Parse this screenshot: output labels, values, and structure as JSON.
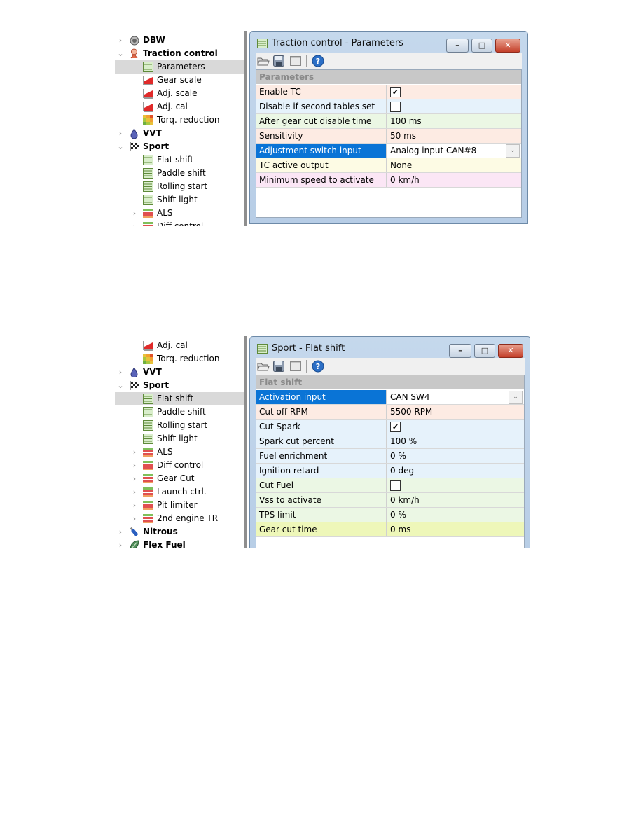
{
  "screenshot1": {
    "tree": [
      {
        "label": "DBW",
        "icon": "throttle-body-icon",
        "bold": true,
        "chevron": "collapsed",
        "level": 0
      },
      {
        "label": "Traction control",
        "icon": "traction-control-icon",
        "bold": true,
        "chevron": "expanded",
        "level": 0
      },
      {
        "label": "Parameters",
        "icon": "parameters-table-icon",
        "level": 1,
        "selected": true
      },
      {
        "label": "Gear scale",
        "icon": "curve-table-icon",
        "level": 1
      },
      {
        "label": "Adj. scale",
        "icon": "curve-table-icon",
        "level": 1
      },
      {
        "label": "Adj. cal",
        "icon": "curve-table-icon",
        "level": 1
      },
      {
        "label": "Torq. reduction",
        "icon": "map-table-icon",
        "level": 1
      },
      {
        "label": "VVT",
        "icon": "oil-drop-icon",
        "bold": true,
        "chevron": "collapsed",
        "level": 0
      },
      {
        "label": "Sport",
        "icon": "checkered-flag-icon",
        "bold": true,
        "chevron": "expanded",
        "level": 0
      },
      {
        "label": "Flat shift",
        "icon": "parameters-table-icon",
        "level": 1
      },
      {
        "label": "Paddle shift",
        "icon": "parameters-table-icon",
        "level": 1
      },
      {
        "label": "Rolling start",
        "icon": "parameters-table-icon",
        "level": 1
      },
      {
        "label": "Shift light",
        "icon": "parameters-table-icon",
        "level": 1
      },
      {
        "label": "ALS",
        "icon": "group-table-icon",
        "chevron": "collapsed",
        "level": 1
      },
      {
        "label": "Diff control",
        "icon": "group-table-icon",
        "chevron": "collapsed",
        "level": 1
      }
    ],
    "window": {
      "title": "Traction control - Parameters",
      "section_header": "Parameters",
      "rows": [
        {
          "label": "Enable TC",
          "type": "checkbox",
          "checked": true,
          "color": "salmon"
        },
        {
          "label": "Disable if second tables set",
          "type": "checkbox",
          "checked": false,
          "color": "blue"
        },
        {
          "label": "After gear cut disable time",
          "value": "100 ms",
          "color": "green"
        },
        {
          "label": "Sensitivity",
          "value": "50 ms",
          "color": "salmon"
        },
        {
          "label": "Adjustment switch input",
          "value": "Analog input CAN#8",
          "type": "dropdown",
          "selected": true
        },
        {
          "label": "TC active output",
          "value": "None",
          "color": "yellow"
        },
        {
          "label": "Minimum speed to activate",
          "value": "0 km/h",
          "color": "pink"
        }
      ]
    }
  },
  "screenshot2": {
    "tree": [
      {
        "label": "Adj. cal",
        "icon": "curve-table-icon",
        "level": 1
      },
      {
        "label": "Torq. reduction",
        "icon": "map-table-icon",
        "level": 1
      },
      {
        "label": "VVT",
        "icon": "oil-drop-icon",
        "bold": true,
        "chevron": "collapsed",
        "level": 0
      },
      {
        "label": "Sport",
        "icon": "checkered-flag-icon",
        "bold": true,
        "chevron": "expanded",
        "level": 0
      },
      {
        "label": "Flat shift",
        "icon": "parameters-table-icon",
        "level": 1,
        "selected": true
      },
      {
        "label": "Paddle shift",
        "icon": "parameters-table-icon",
        "level": 1
      },
      {
        "label": "Rolling start",
        "icon": "parameters-table-icon",
        "level": 1
      },
      {
        "label": "Shift light",
        "icon": "parameters-table-icon",
        "level": 1
      },
      {
        "label": "ALS",
        "icon": "group-table-icon",
        "chevron": "collapsed",
        "level": 1
      },
      {
        "label": "Diff control",
        "icon": "group-table-icon",
        "chevron": "collapsed",
        "level": 1
      },
      {
        "label": "Gear Cut",
        "icon": "group-table-icon",
        "chevron": "collapsed",
        "level": 1
      },
      {
        "label": "Launch ctrl.",
        "icon": "group-table-icon",
        "chevron": "collapsed",
        "level": 1
      },
      {
        "label": "Pit limiter",
        "icon": "group-table-icon",
        "chevron": "collapsed",
        "level": 1
      },
      {
        "label": "2nd engine TR",
        "icon": "group-table-icon",
        "chevron": "collapsed",
        "level": 1
      },
      {
        "label": "Nitrous",
        "icon": "nitrous-bottle-icon",
        "bold": true,
        "chevron": "collapsed",
        "level": 0
      },
      {
        "label": "Flex Fuel",
        "icon": "leaf-icon",
        "bold": true,
        "chevron": "collapsed",
        "level": 0
      }
    ],
    "window": {
      "title": "Sport - Flat shift",
      "section_header": "Flat shift",
      "rows": [
        {
          "label": "Activation input",
          "value": "CAN SW4",
          "type": "dropdown",
          "selected": true
        },
        {
          "label": "Cut off RPM",
          "value": "5500 RPM",
          "color": "salmon"
        },
        {
          "label": "Cut Spark",
          "type": "checkbox",
          "checked": true,
          "color": "blue"
        },
        {
          "label": "Spark cut percent",
          "value": "100 %",
          "color": "blue"
        },
        {
          "label": "Fuel enrichment",
          "value": "0 %",
          "color": "blue"
        },
        {
          "label": "Ignition retard",
          "value": "0 deg",
          "color": "blue"
        },
        {
          "label": "Cut Fuel",
          "type": "checkbox",
          "checked": false,
          "color": "green"
        },
        {
          "label": "Vss to activate",
          "value": "0 km/h",
          "color": "green"
        },
        {
          "label": "TPS limit",
          "value": "0 %",
          "color": "green"
        },
        {
          "label": "Gear cut time",
          "value": "0 ms",
          "color": "lime"
        }
      ]
    }
  },
  "window_controls": {
    "minimize": "–",
    "maximize": "□",
    "close": "✕"
  },
  "toolbar": {
    "open": "open-folder-icon",
    "save": "save-disk-icon",
    "window": "window-icon",
    "help": "?"
  },
  "glyphs": {
    "chevron_collapsed": "›",
    "chevron_expanded": "⌄",
    "dropdown": "⌄",
    "check": "✔"
  }
}
